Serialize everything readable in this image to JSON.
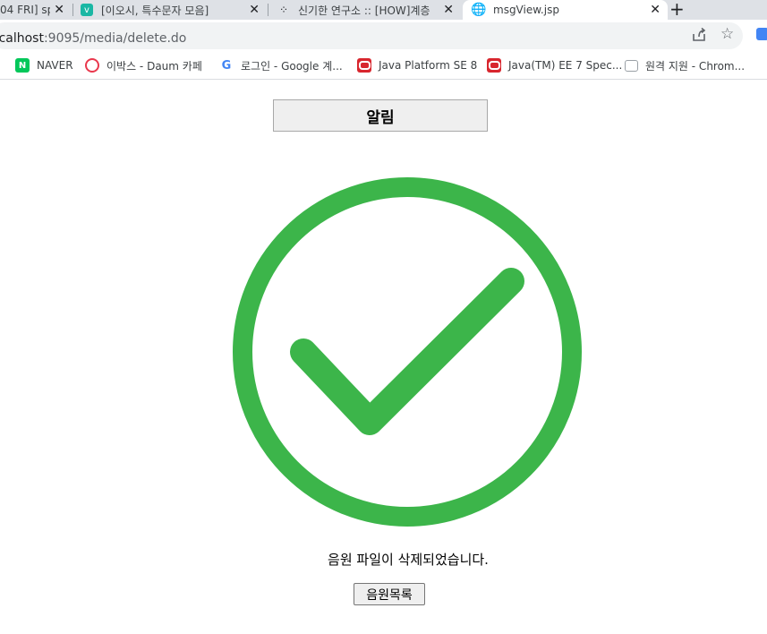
{
  "browser": {
    "tabs": [
      {
        "title": "04 FRI] sp"
      },
      {
        "title": "[이오시, 특수문자 모음]"
      },
      {
        "title": "신기한 연구소 :: [HOW]계층"
      },
      {
        "title": "msgView.jsp"
      }
    ],
    "url": {
      "host": "ocalhost",
      "path": ":9095/media/delete.do"
    },
    "bookmarks": [
      {
        "label": "NAVER",
        "icon": "N"
      },
      {
        "label": "이박스 - Daum 카페"
      },
      {
        "label": "로그인 - Google 계..."
      },
      {
        "label": "Java Platform SE 8"
      },
      {
        "label": "Java(TM) EE 7 Spec..."
      },
      {
        "label": "원격 지원 - Chrom..."
      }
    ]
  },
  "page": {
    "alert_title": "알림",
    "message": "음원 파일이 삭제되었습니다.",
    "list_button_label": "음원목록"
  },
  "colors": {
    "check_green": "#3cb54a"
  }
}
